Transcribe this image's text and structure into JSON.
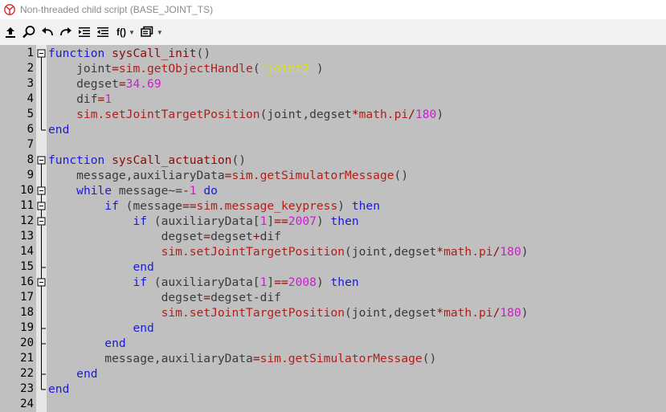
{
  "window": {
    "title": "Non-threaded child script (BASE_JOINT_TS)"
  },
  "toolbar": {
    "items": [
      {
        "name": "upload-icon"
      },
      {
        "name": "search-icon"
      },
      {
        "name": "undo-icon"
      },
      {
        "name": "redo-icon"
      },
      {
        "name": "indent-icon"
      },
      {
        "name": "outdent-icon"
      },
      {
        "name": "functions-dropdown",
        "label": "f()"
      },
      {
        "name": "snippets-dropdown-icon"
      }
    ],
    "functions_label": "f()"
  },
  "editor": {
    "colors": {
      "background": "#c0c0c0",
      "keyword": "#1b1bd6",
      "function_name": "#8b0a0a",
      "api_call": "#b0201a",
      "number": "#c81fc8",
      "string": "#dede1a"
    },
    "lines": [
      {
        "n": "1",
        "fold": "open-top",
        "tokens": [
          [
            "kw",
            "function"
          ],
          [
            "tx",
            " "
          ],
          [
            "fn",
            "sysCall_init"
          ],
          [
            "tx",
            "()"
          ]
        ]
      },
      {
        "n": "2",
        "fold": "line",
        "tokens": [
          [
            "tx",
            "    joint"
          ],
          [
            "op",
            "="
          ],
          [
            "api",
            "sim.getObjectHandle"
          ],
          [
            "tx",
            "("
          ],
          [
            "str",
            "'joint2'"
          ],
          [
            "tx",
            ")"
          ]
        ]
      },
      {
        "n": "3",
        "fold": "line",
        "tokens": [
          [
            "tx",
            "    degset"
          ],
          [
            "op",
            "="
          ],
          [
            "num",
            "34.69"
          ]
        ]
      },
      {
        "n": "4",
        "fold": "line",
        "tokens": [
          [
            "tx",
            "    dif"
          ],
          [
            "op",
            "="
          ],
          [
            "num",
            "1"
          ]
        ]
      },
      {
        "n": "5",
        "fold": "line",
        "tokens": [
          [
            "tx",
            "    "
          ],
          [
            "api",
            "sim.setJointTargetPosition"
          ],
          [
            "tx",
            "(joint,degset"
          ],
          [
            "op",
            "*"
          ],
          [
            "api",
            "math.pi"
          ],
          [
            "op",
            "/"
          ],
          [
            "num",
            "180"
          ],
          [
            "tx",
            ")"
          ]
        ]
      },
      {
        "n": "6",
        "fold": "end",
        "tokens": [
          [
            "kw",
            "end"
          ]
        ]
      },
      {
        "n": "7",
        "fold": "none",
        "tokens": []
      },
      {
        "n": "8",
        "fold": "open-top",
        "tokens": [
          [
            "kw",
            "function"
          ],
          [
            "tx",
            " "
          ],
          [
            "fn",
            "sysCall_actuation"
          ],
          [
            "tx",
            "()"
          ]
        ]
      },
      {
        "n": "9",
        "fold": "line",
        "tokens": [
          [
            "tx",
            "    message,auxiliaryData"
          ],
          [
            "op",
            "="
          ],
          [
            "api",
            "sim.getSimulatorMessage"
          ],
          [
            "tx",
            "()"
          ]
        ]
      },
      {
        "n": "10",
        "fold": "open",
        "tokens": [
          [
            "tx",
            "    "
          ],
          [
            "kw",
            "while"
          ],
          [
            "tx",
            " message~="
          ],
          [
            "op",
            "-"
          ],
          [
            "num",
            "1"
          ],
          [
            "tx",
            " "
          ],
          [
            "kw",
            "do"
          ]
        ]
      },
      {
        "n": "11",
        "fold": "open",
        "tokens": [
          [
            "tx",
            "        "
          ],
          [
            "kw",
            "if"
          ],
          [
            "tx",
            " (message"
          ],
          [
            "op",
            "=="
          ],
          [
            "api",
            "sim.message_keypress"
          ],
          [
            "tx",
            ") "
          ],
          [
            "kw",
            "then"
          ]
        ]
      },
      {
        "n": "12",
        "fold": "open",
        "tokens": [
          [
            "tx",
            "            "
          ],
          [
            "kw",
            "if"
          ],
          [
            "tx",
            " (auxiliaryData["
          ],
          [
            "num",
            "1"
          ],
          [
            "tx",
            "]"
          ],
          [
            "op",
            "=="
          ],
          [
            "num",
            "2007"
          ],
          [
            "tx",
            ") "
          ],
          [
            "kw",
            "then"
          ]
        ]
      },
      {
        "n": "13",
        "fold": "line",
        "tokens": [
          [
            "tx",
            "                degset"
          ],
          [
            "op",
            "="
          ],
          [
            "tx",
            "degset"
          ],
          [
            "op",
            "+"
          ],
          [
            "tx",
            "dif"
          ]
        ]
      },
      {
        "n": "14",
        "fold": "line",
        "tokens": [
          [
            "tx",
            "                "
          ],
          [
            "api",
            "sim.setJointTargetPosition"
          ],
          [
            "tx",
            "(joint,degset"
          ],
          [
            "op",
            "*"
          ],
          [
            "api",
            "math.pi"
          ],
          [
            "op",
            "/"
          ],
          [
            "num",
            "180"
          ],
          [
            "tx",
            ")"
          ]
        ]
      },
      {
        "n": "15",
        "fold": "end-mid",
        "tokens": [
          [
            "tx",
            "            "
          ],
          [
            "kw",
            "end"
          ]
        ]
      },
      {
        "n": "16",
        "fold": "open",
        "tokens": [
          [
            "tx",
            "            "
          ],
          [
            "kw",
            "if"
          ],
          [
            "tx",
            " (auxiliaryData["
          ],
          [
            "num",
            "1"
          ],
          [
            "tx",
            "]"
          ],
          [
            "op",
            "=="
          ],
          [
            "num",
            "2008"
          ],
          [
            "tx",
            ") "
          ],
          [
            "kw",
            "then"
          ]
        ]
      },
      {
        "n": "17",
        "fold": "line",
        "tokens": [
          [
            "tx",
            "                degset"
          ],
          [
            "op",
            "="
          ],
          [
            "tx",
            "degset"
          ],
          [
            "op",
            "-"
          ],
          [
            "tx",
            "dif"
          ]
        ]
      },
      {
        "n": "18",
        "fold": "line",
        "tokens": [
          [
            "tx",
            "                "
          ],
          [
            "api",
            "sim.setJointTargetPosition"
          ],
          [
            "tx",
            "(joint,degset"
          ],
          [
            "op",
            "*"
          ],
          [
            "api",
            "math.pi"
          ],
          [
            "op",
            "/"
          ],
          [
            "num",
            "180"
          ],
          [
            "tx",
            ")"
          ]
        ]
      },
      {
        "n": "19",
        "fold": "end-mid",
        "tokens": [
          [
            "tx",
            "            "
          ],
          [
            "kw",
            "end"
          ]
        ]
      },
      {
        "n": "20",
        "fold": "end-mid",
        "tokens": [
          [
            "tx",
            "        "
          ],
          [
            "kw",
            "end"
          ]
        ]
      },
      {
        "n": "21",
        "fold": "line",
        "tokens": [
          [
            "tx",
            "        message,auxiliaryData"
          ],
          [
            "op",
            "="
          ],
          [
            "api",
            "sim.getSimulatorMessage"
          ],
          [
            "tx",
            "()"
          ]
        ]
      },
      {
        "n": "22",
        "fold": "end-mid",
        "tokens": [
          [
            "tx",
            "    "
          ],
          [
            "kw",
            "end"
          ]
        ]
      },
      {
        "n": "23",
        "fold": "end",
        "tokens": [
          [
            "kw",
            "end"
          ]
        ]
      },
      {
        "n": "24",
        "fold": "none",
        "tokens": []
      }
    ]
  }
}
